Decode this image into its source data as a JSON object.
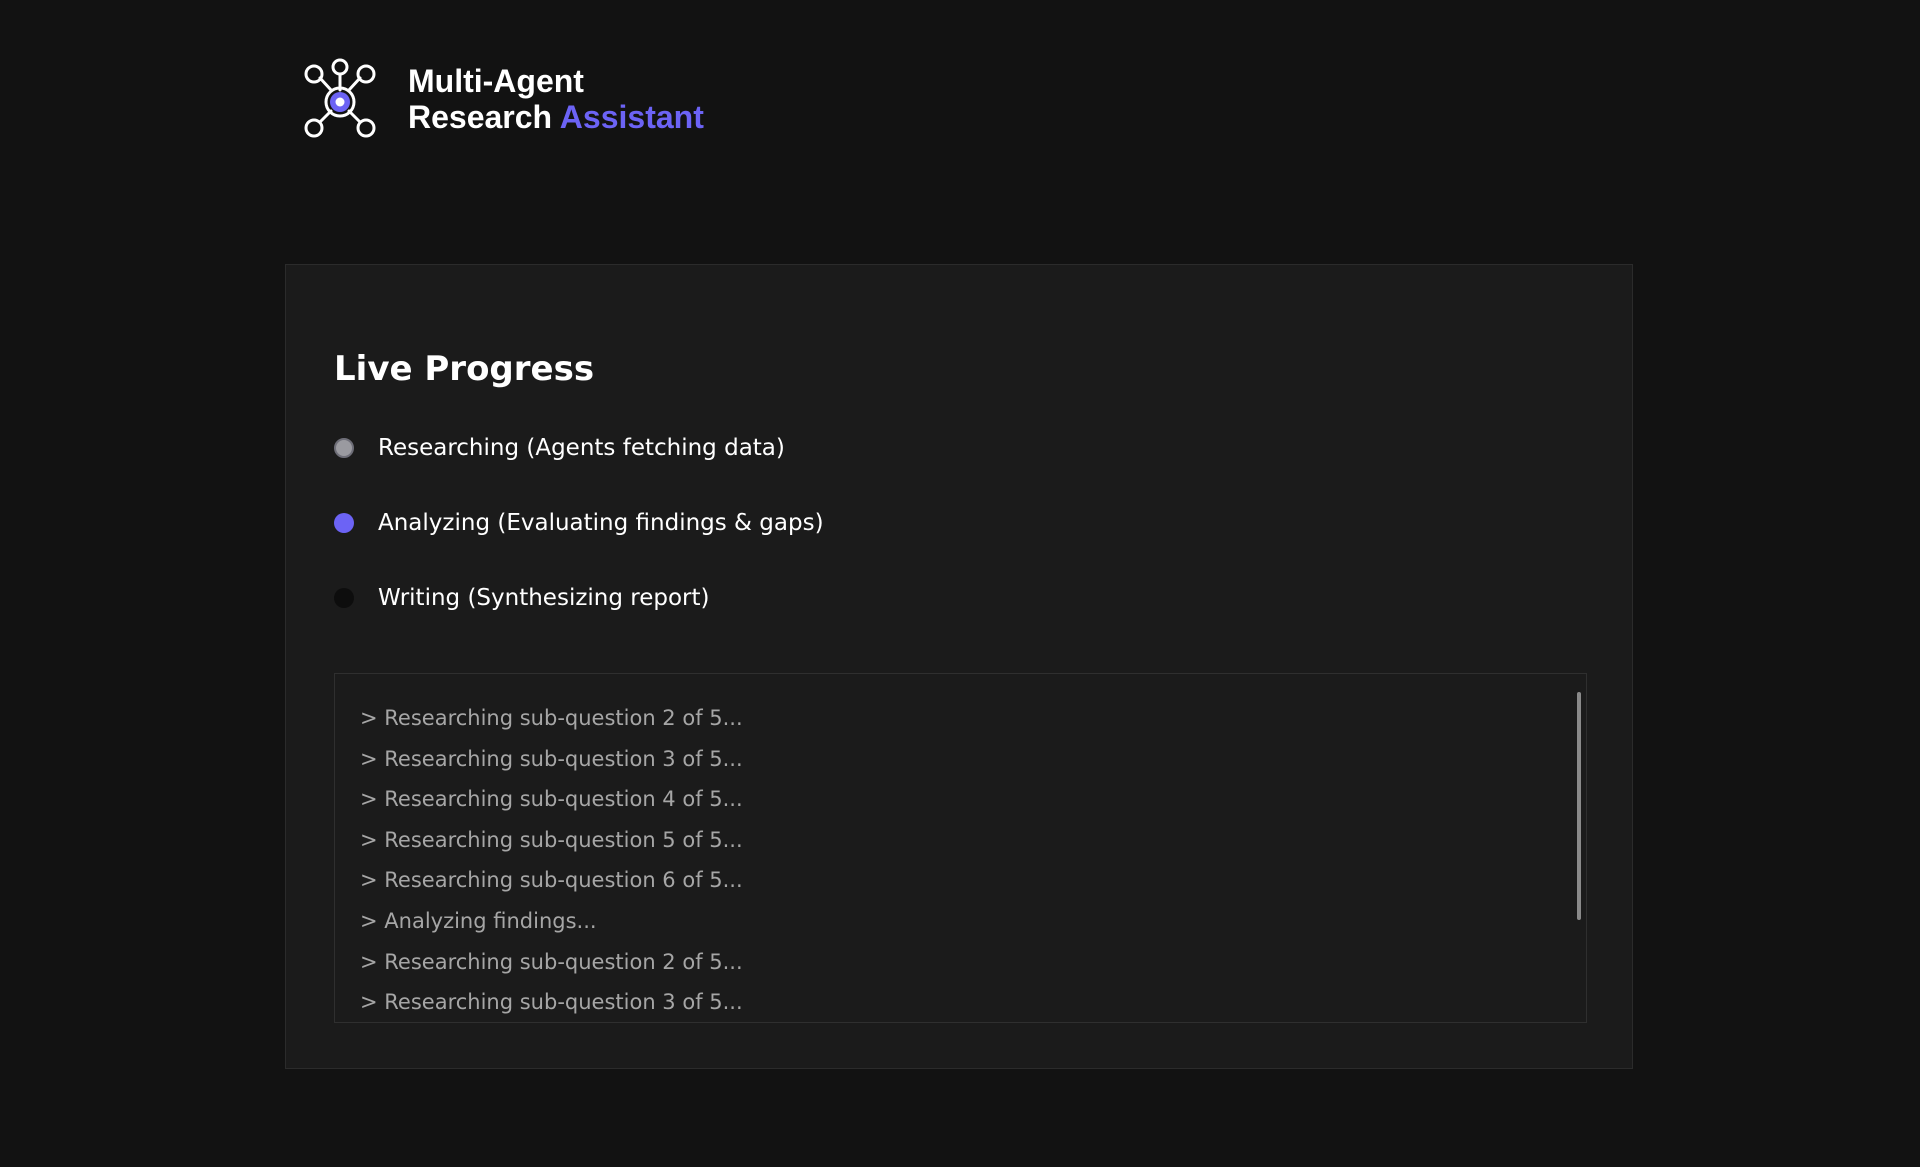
{
  "brand": {
    "title_line1": "Multi-Agent",
    "title_line2": "Research",
    "title_accent": "Assistant",
    "logo_icon": "network-nodes-icon",
    "accent_color": "#6c63f5"
  },
  "progress": {
    "title": "Live Progress",
    "steps": [
      {
        "label": "Researching (Agents fetching data)",
        "status": "done",
        "color": "#9a9aa0"
      },
      {
        "label": "Analyzing (Evaluating findings & gaps)",
        "status": "active",
        "color": "#6c63f5"
      },
      {
        "label": "Writing (Synthesizing report)",
        "status": "pending",
        "color": "#0d0d0d"
      }
    ],
    "log": [
      "> Researching sub-question 2 of 5...",
      "> Researching sub-question 3 of 5...",
      "> Researching sub-question 4 of 5...",
      "> Researching sub-question 5 of 5...",
      "> Researching sub-question 6 of 5...",
      "> Analyzing findings...",
      "> Researching sub-question 2 of 5...",
      "> Researching sub-question 3 of 5..."
    ]
  }
}
